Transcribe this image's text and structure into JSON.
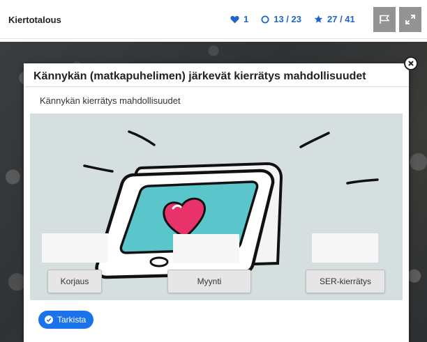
{
  "header": {
    "title": "Kiertotalous",
    "stats": {
      "hearts": "1",
      "progress": "13 / 23",
      "stars": "27 / 41"
    },
    "buttons": {
      "flag_icon": "flag-icon",
      "expand_icon": "expand-icon"
    }
  },
  "modal": {
    "title": "Kännykän (matkapuhelimen) järkevät kierrätys mahdollisuudet",
    "subtitle": "Kännykän kierrätys mahdollisuudet",
    "close_icon": "close-icon",
    "drop_zones": [
      "",
      "",
      ""
    ],
    "options": [
      "Korjaus",
      "Myynti",
      "SER-kierrätys"
    ],
    "check_button": "Tarkista"
  },
  "colors": {
    "accent": "#1a73e8",
    "stats_blue": "#1f64c8",
    "toolbar_button": "#939393",
    "task_background": "#d5dfdf",
    "phone_screen": "#5bc5cc",
    "heart": "#e8336a"
  }
}
